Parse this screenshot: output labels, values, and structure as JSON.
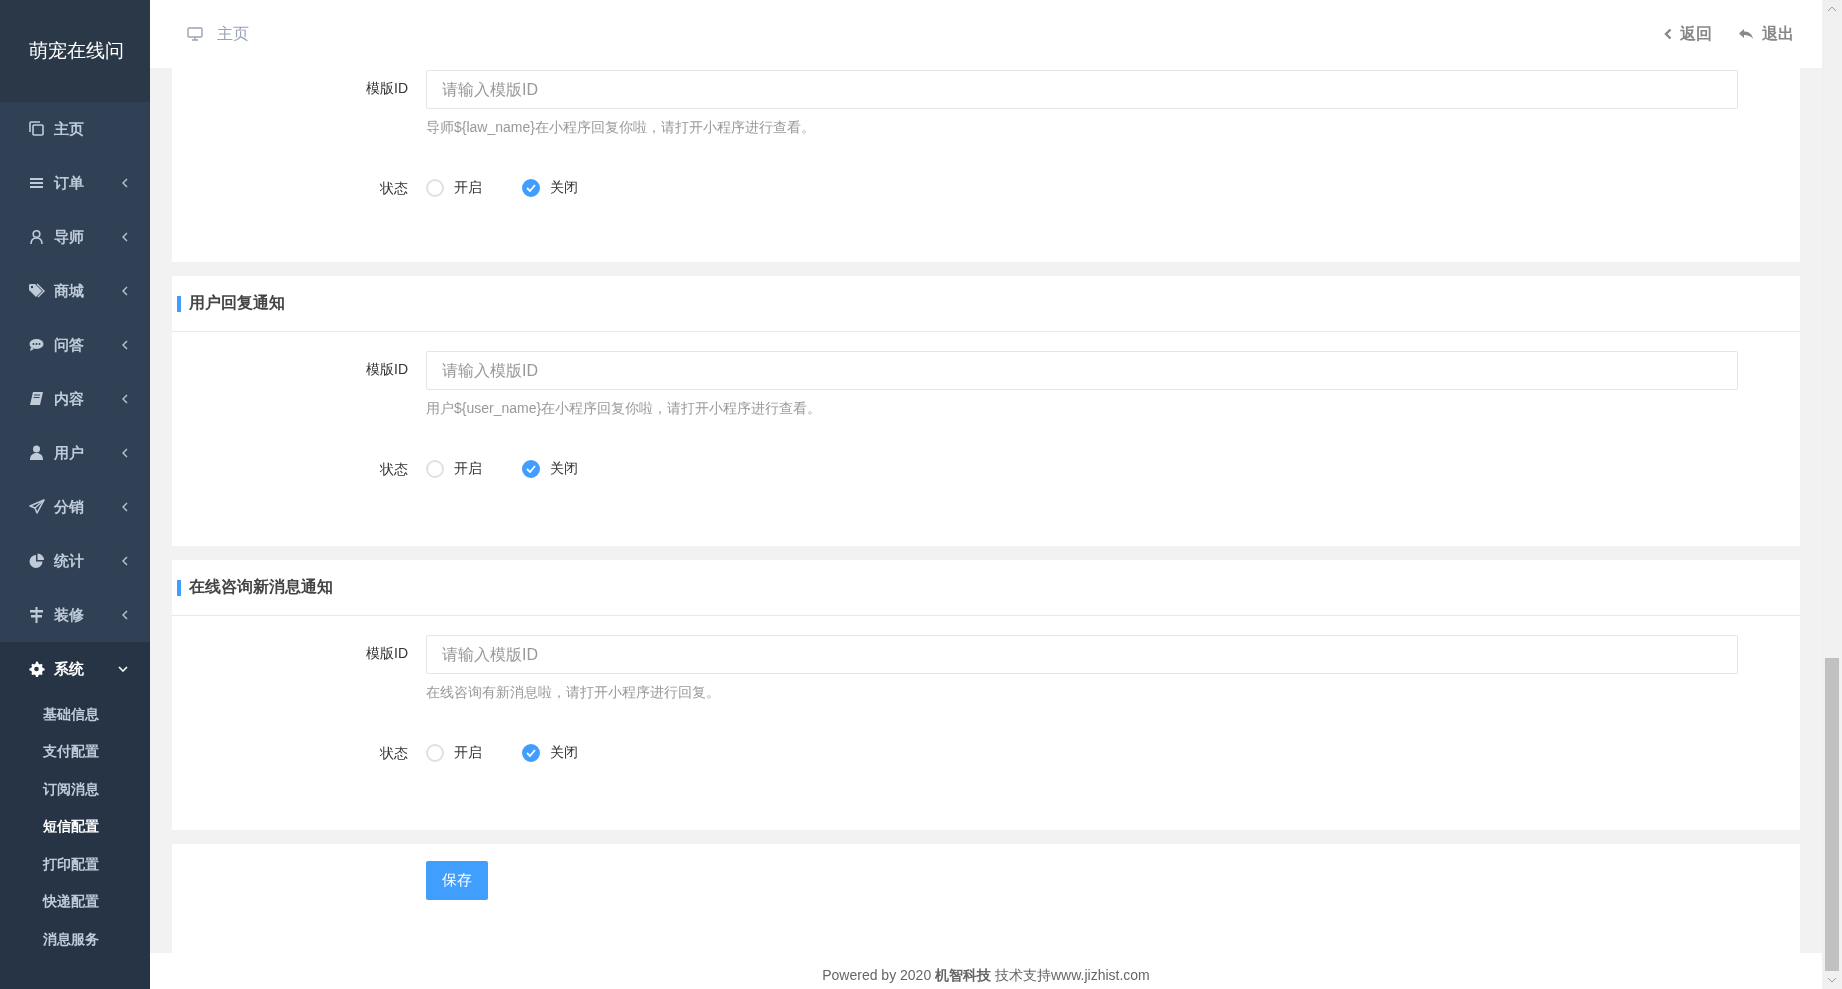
{
  "sidebar": {
    "brand": "萌宠在线问",
    "items": [
      {
        "label": "主页"
      },
      {
        "label": "订单",
        "expanded": false
      },
      {
        "label": "导师",
        "expanded": false
      },
      {
        "label": "商城",
        "expanded": false
      },
      {
        "label": "问答",
        "expanded": false
      },
      {
        "label": "内容",
        "expanded": false
      },
      {
        "label": "用户",
        "expanded": false
      },
      {
        "label": "分销",
        "expanded": false
      },
      {
        "label": "统计",
        "expanded": false
      },
      {
        "label": "装修",
        "expanded": false
      },
      {
        "label": "系统",
        "expanded": true,
        "children": [
          {
            "label": "基础信息",
            "selected": false
          },
          {
            "label": "支付配置",
            "selected": false
          },
          {
            "label": "订阅消息",
            "selected": false
          },
          {
            "label": "短信配置",
            "selected": true
          },
          {
            "label": "打印配置",
            "selected": false
          },
          {
            "label": "快递配置",
            "selected": false
          },
          {
            "label": "消息服务",
            "selected": false
          }
        ]
      }
    ]
  },
  "header": {
    "breadcrumb": "主页",
    "actions": [
      "返回",
      "退出"
    ]
  },
  "sections": [
    {
      "field_label": "模版ID",
      "placeholder": "请输入模版ID",
      "hint": "导师${law_name}在小程序回复你啦，请打开小程序进行查看。",
      "status_label": "状态",
      "options": [
        {
          "label": "开启",
          "selected": false
        },
        {
          "label": "关闭",
          "selected": true
        }
      ]
    },
    {
      "title": "用户回复通知",
      "field_label": "模版ID",
      "placeholder": "请输入模版ID",
      "hint": "用户${user_name}在小程序回复你啦，请打开小程序进行查看。",
      "status_label": "状态",
      "options": [
        {
          "label": "开启",
          "selected": false
        },
        {
          "label": "关闭",
          "selected": true
        }
      ]
    },
    {
      "title": "在线咨询新消息通知",
      "field_label": "模版ID",
      "placeholder": "请输入模版ID",
      "hint": "在线咨询有新消息啦，请打开小程序进行回复。",
      "status_label": "状态",
      "options": [
        {
          "label": "开启",
          "selected": false
        },
        {
          "label": "关闭",
          "selected": true
        }
      ]
    }
  ],
  "save_button": "保存",
  "footer": "Powered by 2020 **机智科技** 技术支持www.jizhist.com"
}
